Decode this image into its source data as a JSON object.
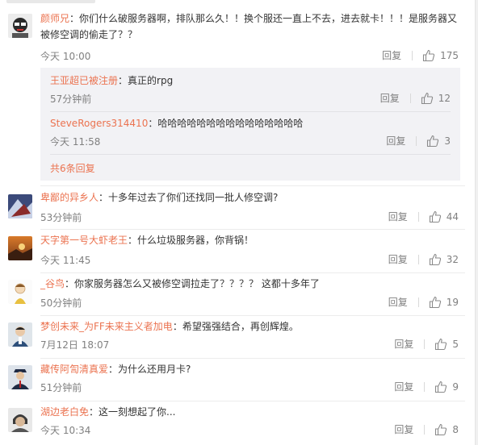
{
  "comments": [
    {
      "user": "颜师兄",
      "text": "你们什么破服务器啊，排队那么久！！换个服还一直上不去，进去就卡！！！是服务器又被修空调的偷走了？？",
      "time": "今天 10:00",
      "reply": "回复",
      "likes": "175",
      "sub_comments": [
        {
          "user": "王亚超已被注册",
          "text": "真正的rpg",
          "time": "57分钟前",
          "reply": "回复",
          "likes": "12"
        },
        {
          "user": "SteveRogers314410",
          "text": "哈哈哈哈哈哈哈哈哈哈哈哈哈哈哈",
          "time": "今天 11:58",
          "reply": "回复",
          "likes": "3"
        }
      ],
      "total_replies": "共6条回复"
    },
    {
      "user": "卑鄙的异乡人",
      "text": "十多年过去了你们还找同一批人修空调?",
      "time": "53分钟前",
      "reply": "回复",
      "likes": "44"
    },
    {
      "user": "天字第一号大虾老王",
      "text": "什么垃圾服务器，你背锅！",
      "time": "今天 11:45",
      "reply": "回复",
      "likes": "32"
    },
    {
      "user": "_谷鸟",
      "text": "你家服务器怎么又被修空调拉走了？？？？ 这都十多年了",
      "time": "50分钟前",
      "reply": "回复",
      "likes": "19"
    },
    {
      "user": "梦创未来_为FF未来主义者加电",
      "text": "希望强强结合，再创辉煌。",
      "time": "7月12日 18:07",
      "reply": "回复",
      "likes": "5"
    },
    {
      "user": "藏传阿訇清真爱",
      "text": "为什么还用月卡?",
      "time": "51分钟前",
      "reply": "回复",
      "likes": "9"
    },
    {
      "user": "湖边老白免",
      "text": "这一刻想起了你...",
      "time": "今天 10:34",
      "reply": "回复",
      "likes": "8"
    }
  ],
  "colors": {
    "username": "#eb7350",
    "meta": "#808080",
    "subbox": "#f2f2f5"
  }
}
